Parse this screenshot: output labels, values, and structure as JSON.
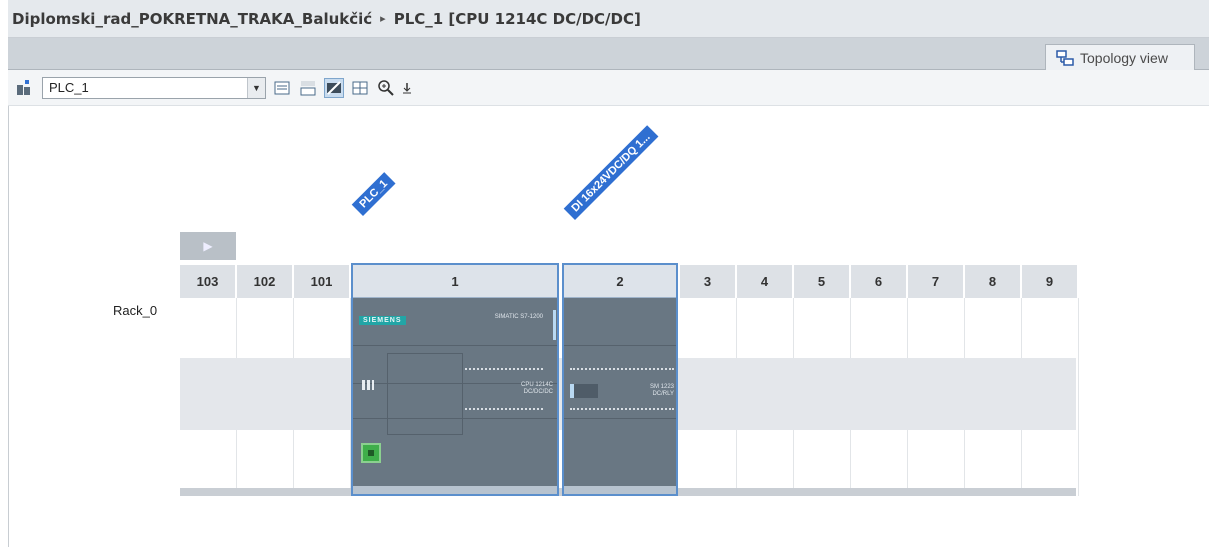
{
  "window": {
    "project": "Diplomski_rad_POKRETNA_TRAKA_Balukčić",
    "separator": "▸",
    "device": "PLC_1 [CPU 1214C DC/DC/DC]"
  },
  "tabs": {
    "topology_label": "Topology view"
  },
  "toolbar": {
    "device_select_value": "PLC_1",
    "icons": [
      "device-add-icon",
      "properties-icon",
      "show-names-icon",
      "show-graphics-icon",
      "table-icon",
      "zoom-icon",
      "more-down-icon"
    ]
  },
  "rack": {
    "name": "Rack_0",
    "slots": [
      "103",
      "102",
      "101",
      "1",
      "2",
      "3",
      "4",
      "5",
      "6",
      "7",
      "8",
      "9"
    ],
    "modules": {
      "plc": {
        "label": "PLC_1",
        "logo": "SIEMENS",
        "series": "SIMATIC S7-1200",
        "cpu_line1": "CPU 1214C",
        "cpu_line2": "DC/DC/DC"
      },
      "io": {
        "label": "DI 16x24VDC/DQ 1...",
        "sm_line1": "SM 1223",
        "sm_line2": "DC/RLY"
      }
    }
  },
  "colors": {
    "selection": "#2f6fd1",
    "module_body": "#697783",
    "slot_header": "#dde1e6"
  }
}
